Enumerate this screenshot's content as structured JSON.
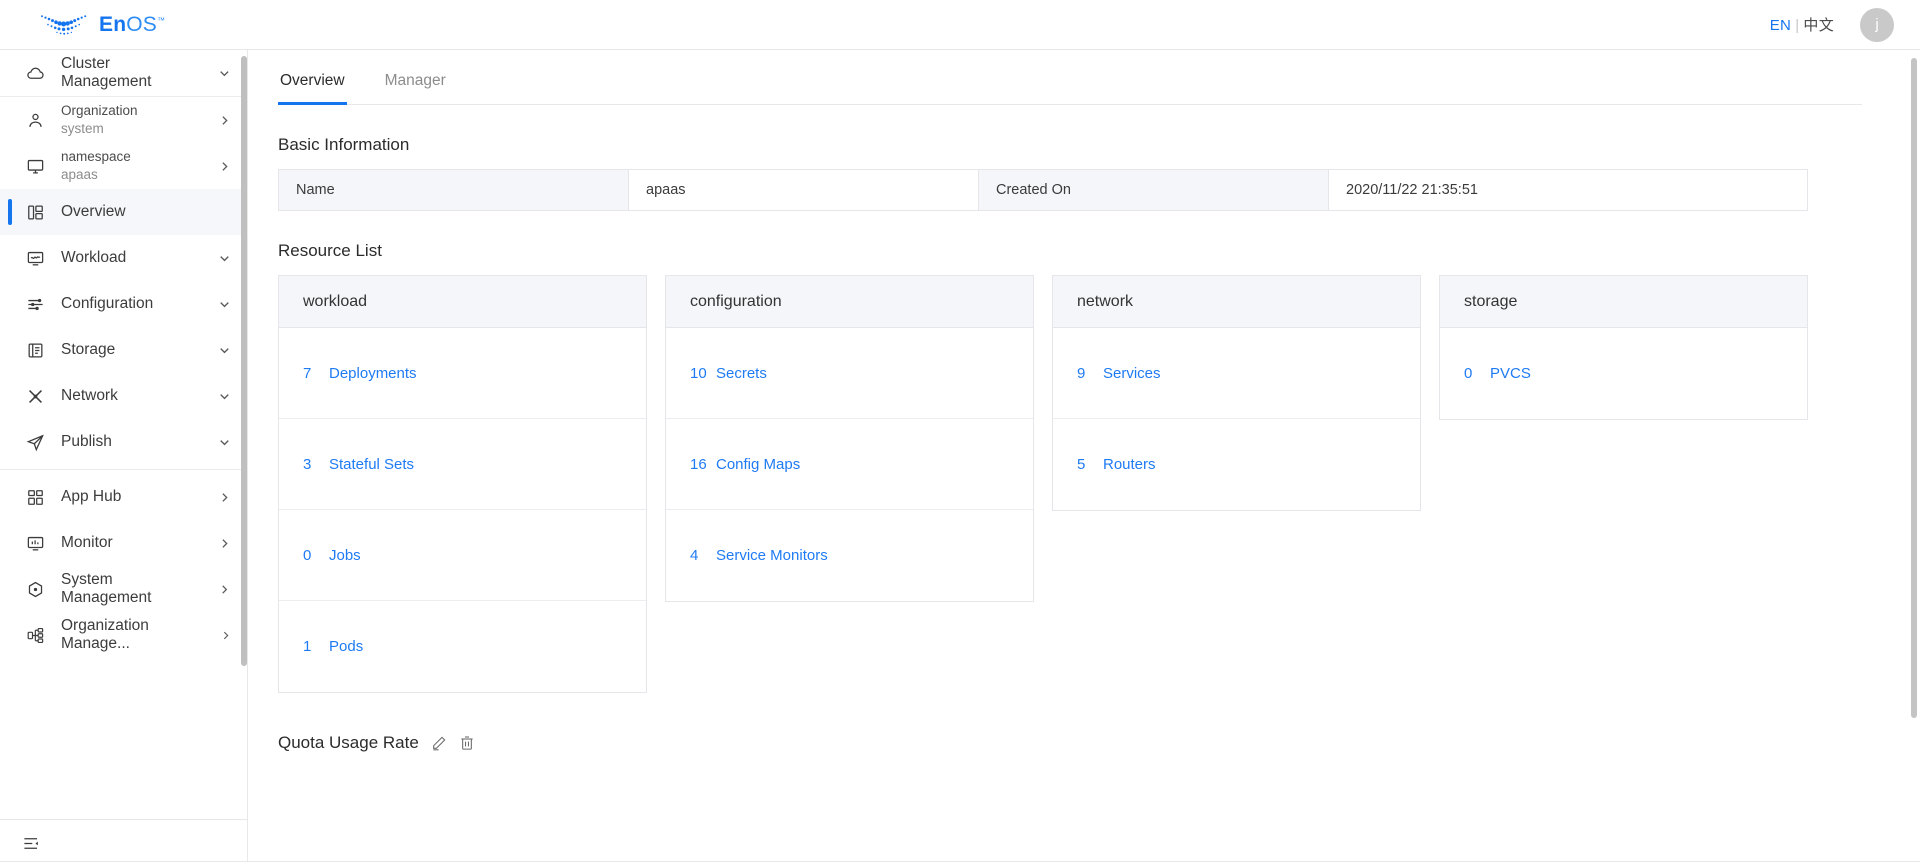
{
  "header": {
    "logo_text_en": "En",
    "logo_text_os": "OS",
    "logo_tm": "™",
    "lang_en": "EN",
    "lang_sep": "|",
    "lang_zh": "中文",
    "avatar_initial": "j"
  },
  "sidebar": {
    "cluster": {
      "label": "Cluster Management",
      "icon": "cloud-icon",
      "caret": "chevron-down-icon"
    },
    "context": [
      {
        "title": "Organization",
        "value": "system",
        "icon": "user-icon",
        "caret": "chevron-right-icon"
      },
      {
        "title": "namespace",
        "value": "apaas",
        "icon": "monitor-icon",
        "caret": "chevron-right-icon"
      }
    ],
    "items": [
      {
        "label": "Overview",
        "icon": "dashboard-icon",
        "caret": "",
        "active": true
      },
      {
        "label": "Workload",
        "icon": "workload-icon",
        "caret": "chevron-down-icon",
        "active": false
      },
      {
        "label": "Configuration",
        "icon": "sliders-icon",
        "caret": "chevron-down-icon",
        "active": false
      },
      {
        "label": "Storage",
        "icon": "storage-icon",
        "caret": "chevron-down-icon",
        "active": false
      },
      {
        "label": "Network",
        "icon": "network-icon",
        "caret": "chevron-down-icon",
        "active": false
      },
      {
        "label": "Publish",
        "icon": "send-icon",
        "caret": "chevron-down-icon",
        "active": false
      }
    ],
    "items2": [
      {
        "label": "App Hub",
        "icon": "grid-icon",
        "caret": "chevron-right-icon"
      },
      {
        "label": "Monitor",
        "icon": "monitor-chart-icon",
        "caret": "chevron-right-icon"
      },
      {
        "label": "System Management",
        "icon": "target-icon",
        "caret": "chevron-right-icon"
      },
      {
        "label": "Organization Manage...",
        "icon": "org-tree-icon",
        "caret": "chevron-right-icon"
      }
    ],
    "collapse_icon": "collapse-sidebar-icon"
  },
  "main": {
    "tabs": [
      {
        "label": "Overview",
        "active": true
      },
      {
        "label": "Manager",
        "active": false
      }
    ],
    "basic_information": {
      "title": "Basic Information",
      "cells": [
        {
          "text": "Name",
          "type": "key"
        },
        {
          "text": "apaas",
          "type": "value"
        },
        {
          "text": "Created On",
          "type": "key"
        },
        {
          "text": "2020/11/22 21:35:51",
          "type": "value"
        }
      ]
    },
    "resource_list": {
      "title": "Resource List",
      "cards": [
        {
          "title": "workload",
          "rows": [
            {
              "count": "7",
              "label": "Deployments"
            },
            {
              "count": "3",
              "label": "Stateful Sets"
            },
            {
              "count": "0",
              "label": "Jobs"
            },
            {
              "count": "1",
              "label": "Pods"
            }
          ]
        },
        {
          "title": "configuration",
          "rows": [
            {
              "count": "10",
              "label": "Secrets"
            },
            {
              "count": "16",
              "label": "Config Maps"
            },
            {
              "count": "4",
              "label": "Service Monitors"
            }
          ]
        },
        {
          "title": "network",
          "rows": [
            {
              "count": "9",
              "label": "Services"
            },
            {
              "count": "5",
              "label": "Routers"
            }
          ]
        },
        {
          "title": "storage",
          "rows": [
            {
              "count": "0",
              "label": "PVCS"
            }
          ]
        }
      ]
    },
    "quota": {
      "title": "Quota Usage Rate",
      "edit_icon": "pencil-icon",
      "delete_icon": "trash-icon"
    }
  },
  "colors": {
    "accent": "#1575ef",
    "link": "#1f7bf4",
    "header_bg": "#f5f6fa",
    "border": "#e6e6ea"
  }
}
